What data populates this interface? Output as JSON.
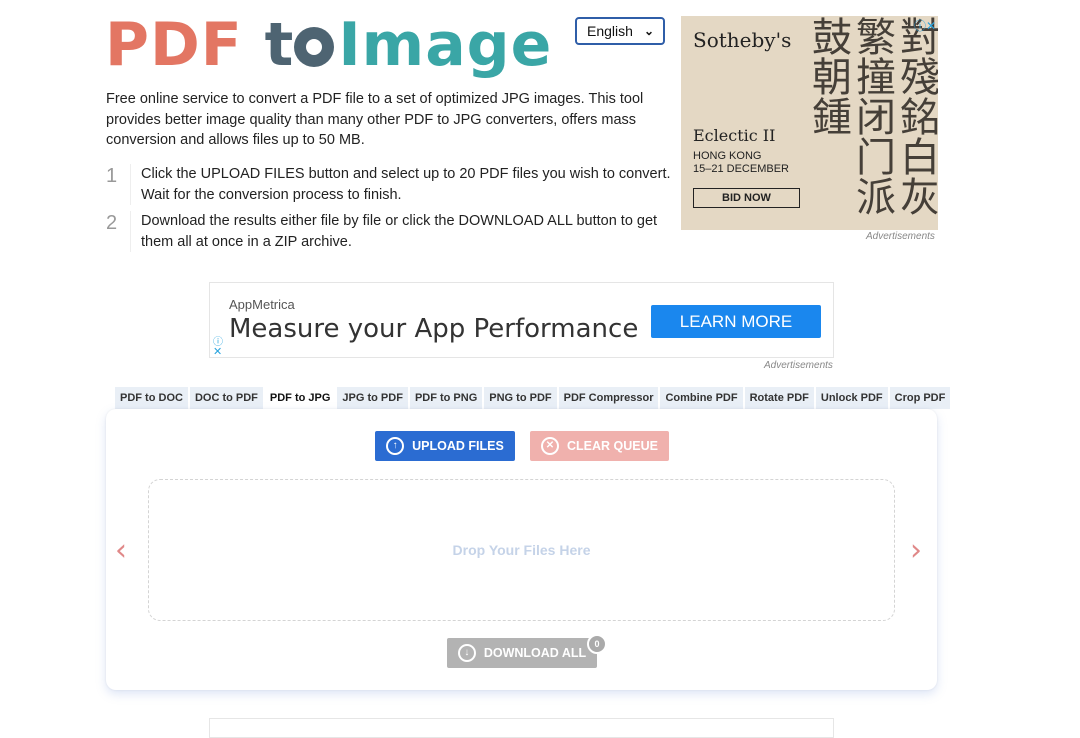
{
  "logo": {
    "part1": "PDF",
    "part2": "t",
    "part3": "Image"
  },
  "language": {
    "selected": "English"
  },
  "intro": "Free online service to convert a PDF file to a set of optimized JPG images. This tool provides better image quality than many other PDF to JPG converters, offers mass conversion and allows files up to 50 MB.",
  "steps": [
    {
      "num": "1",
      "text": "Click the UPLOAD FILES button and select up to 20 PDF files you wish to convert. Wait for the conversion process to finish."
    },
    {
      "num": "2",
      "text": "Download the results either file by file or click the DOWNLOAD ALL button to get them all at once in a ZIP archive."
    }
  ],
  "ad_right": {
    "brand": "Sotheby's",
    "calligraphy": "對殘銘白灰繁撞闭门派鼓朝鍾",
    "title": "Eclectic II",
    "location": "HONG KONG",
    "dates": "15–21 DECEMBER",
    "cta": "BID NOW",
    "label": "Advertisements"
  },
  "ad_banner": {
    "advertiser": "AppMetrica",
    "headline": "Measure your App Performance",
    "cta": "LEARN MORE",
    "label": "Advertisements"
  },
  "tabs": [
    {
      "label": "PDF to DOC",
      "active": false
    },
    {
      "label": "DOC to PDF",
      "active": false
    },
    {
      "label": "PDF to JPG",
      "active": true
    },
    {
      "label": "JPG to PDF",
      "active": false
    },
    {
      "label": "PDF to PNG",
      "active": false
    },
    {
      "label": "PNG to PDF",
      "active": false
    },
    {
      "label": "PDF Compressor",
      "active": false
    },
    {
      "label": "Combine PDF",
      "active": false
    },
    {
      "label": "Rotate PDF",
      "active": false
    },
    {
      "label": "Unlock PDF",
      "active": false
    },
    {
      "label": "Crop PDF",
      "active": false
    }
  ],
  "converter": {
    "upload_label": "UPLOAD FILES",
    "clear_label": "CLEAR QUEUE",
    "drop_text": "Drop Your Files Here",
    "download_label": "DOWNLOAD ALL",
    "file_count": "0",
    "prev_arrow": "‹",
    "next_arrow": "›"
  }
}
